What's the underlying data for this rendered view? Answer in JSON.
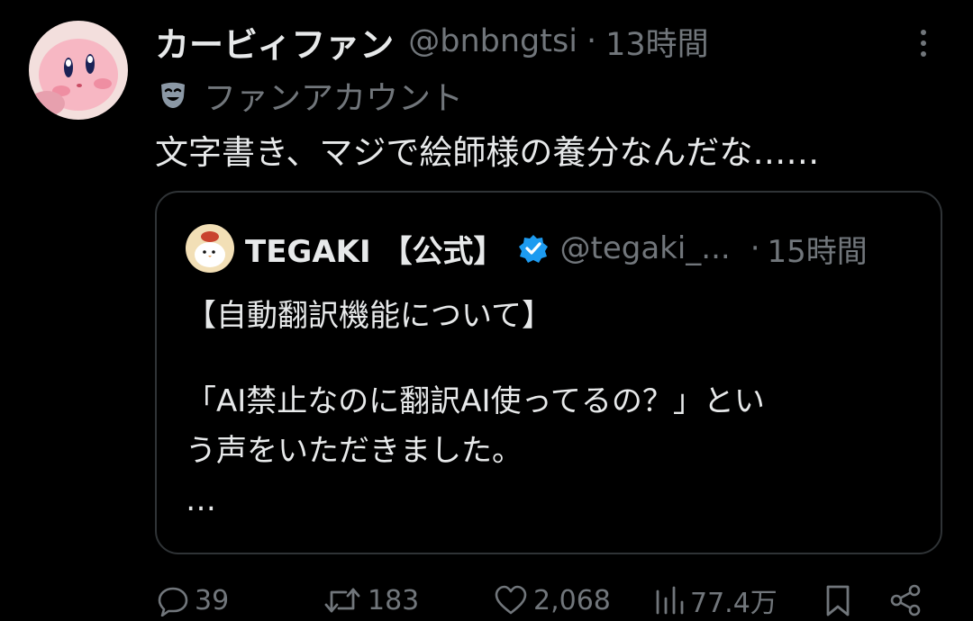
{
  "post": {
    "display_name": "カービィファン",
    "handle": "@bnbngtsi",
    "separator": "·",
    "time": "13時間",
    "label": "ファンアカウント",
    "text": "文字書き、マジで絵師様の養分なんだな……"
  },
  "quote": {
    "display_name": "TEGAKI 【公式】",
    "handle": "@tegaki_...",
    "separator": "·",
    "time": "15時間",
    "lines": [
      "【自動翻訳機能について】",
      "",
      "「AI禁止なのに翻訳AI使ってるの？」とい",
      "う声をいただきました。",
      "…"
    ]
  },
  "actions": {
    "replies": "39",
    "reposts": "183",
    "likes": "2,068",
    "views": "77.4万"
  },
  "icons": {
    "more": "more-vertical-icon",
    "label": "theater-mask-icon",
    "verified": "verified-badge-icon",
    "reply": "reply-icon",
    "repost": "repost-icon",
    "like": "heart-icon",
    "views": "views-chart-icon",
    "bookmark": "bookmark-icon",
    "share": "share-icon"
  },
  "colors": {
    "background": "#000000",
    "text_primary": "#e7e9ea",
    "text_secondary": "#71767b",
    "border": "#2f3336",
    "verified": "#1d9bf0"
  }
}
